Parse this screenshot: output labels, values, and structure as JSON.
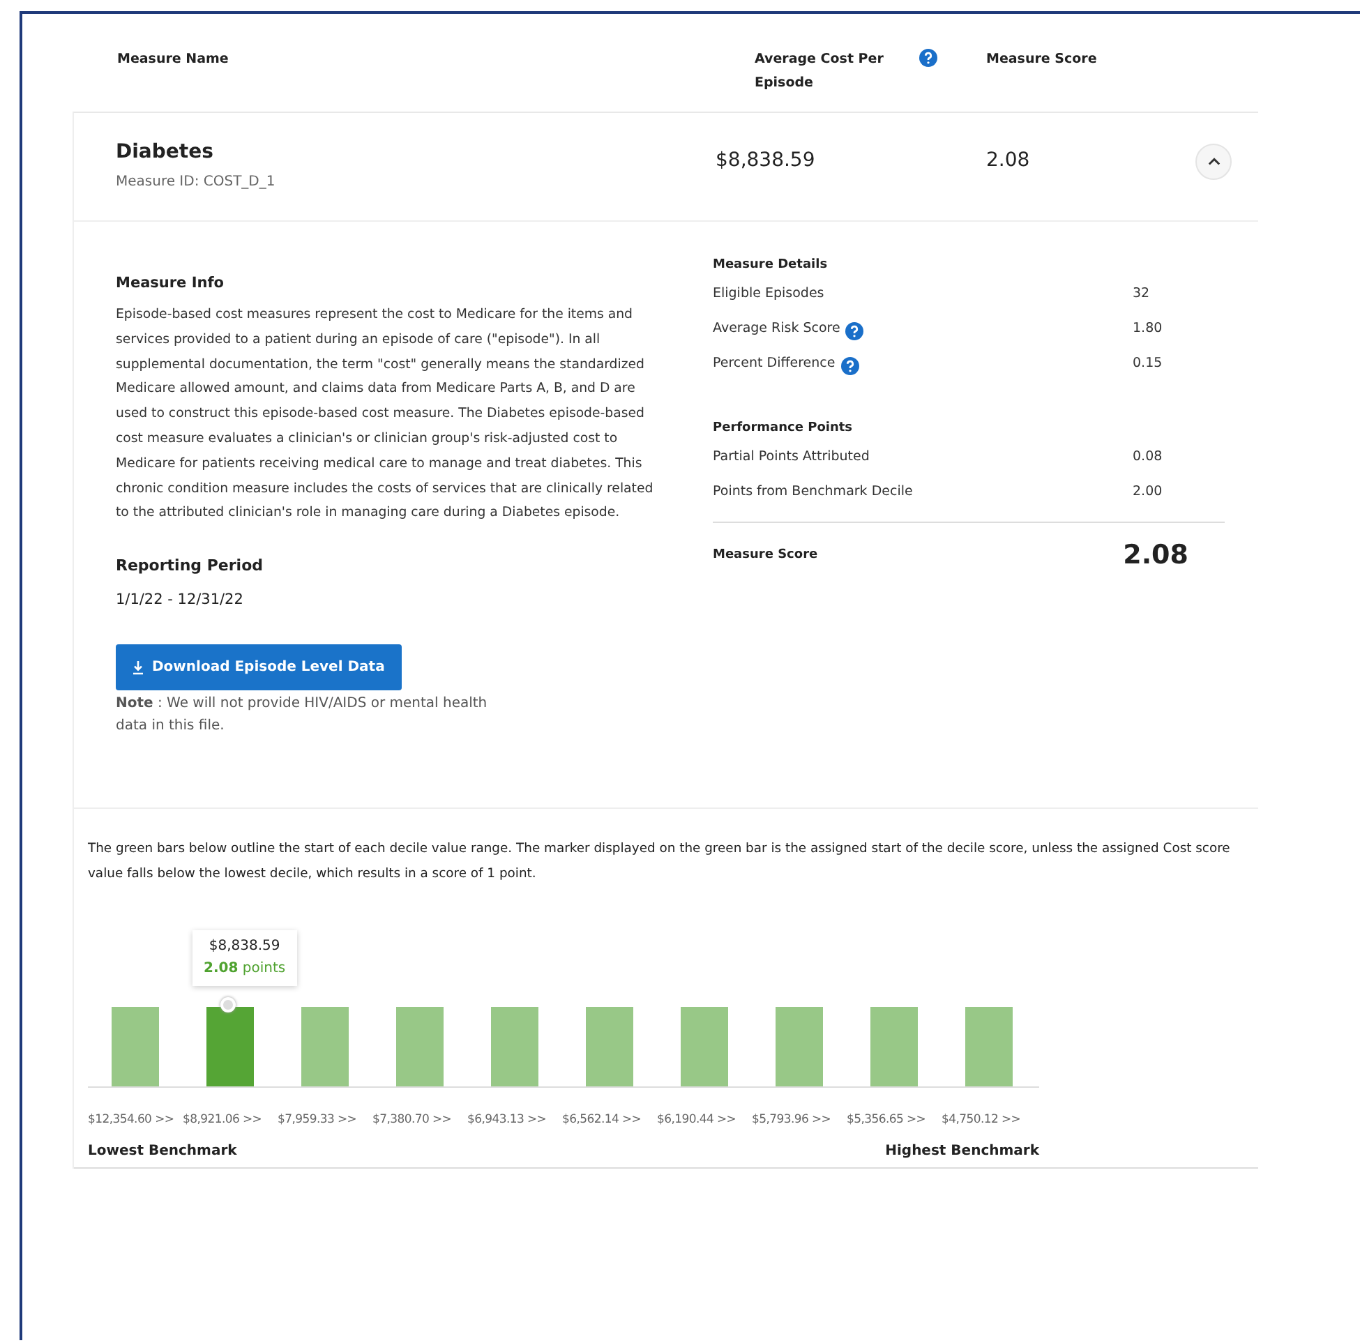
{
  "table": {
    "columns": [
      {
        "label": "Measure Name",
        "help": false
      },
      {
        "label": "Average Cost Per Episode",
        "help": true
      },
      {
        "label": "Measure Score",
        "help": false
      }
    ]
  },
  "measure": {
    "name": "Diabetes",
    "id_text": "Measure ID: COST_D_1",
    "average_cost": "$8,838.59",
    "score": "2.08",
    "expanded": true
  },
  "measure_info": {
    "title": "Measure Info",
    "text": "Episode-based cost measures represent the cost to Medicare for the items and services provided to a patient during an episode of care (\"episode\"). In all supplemental documentation, the term \"cost\" generally means the standardized Medicare allowed amount, and claims data from Medicare Parts A, B, and D are used to construct this episode-based cost measure. The Diabetes episode-based cost measure evaluates a clinician's or clinician group's risk-adjusted cost to Medicare for patients receiving medical care to manage and treat diabetes. This chronic condition measure includes the costs of services that are clinically related to the attributed clinician's role in managing care during a Diabetes episode."
  },
  "reporting_period": {
    "title": "Reporting Period",
    "value": "1/1/22 - 12/31/22"
  },
  "download_button": "Download Episode Level Data",
  "note": "**Note** : We will not provide HIV/AIDS or mental health data in this file.",
  "detail_groups": [
    {
      "title": "Measure Details",
      "rows": [
        {
          "label": "Eligible Episodes",
          "value": "32",
          "help": false
        },
        {
          "label": "Average Risk Score",
          "value": "1.80",
          "help": true
        },
        {
          "label": "Percent Difference",
          "value": "0.15",
          "help": true
        }
      ]
    },
    {
      "title": "Performance Points",
      "rows": [
        {
          "label": "Partial Points Attributed",
          "value": "0.08",
          "help": false
        },
        {
          "label": "Points from Benchmark Decile",
          "value": "2.00",
          "help": false
        }
      ]
    }
  ],
  "total": {
    "label": "Measure Score",
    "value": "2.08"
  },
  "benchmark": {
    "description": "The green bars below outline the start of each decile value range. The marker displayed on the green bar is the assigned start of the decile score, unless the assigned Cost score value falls below the lowest decile, which results in a score of 1 point.",
    "tooltip": {
      "cost": "$8,838.59",
      "points": "2.08",
      "points_label": "points"
    },
    "deciles": [
      {
        "label": "$12,354.60 >>",
        "selected": false
      },
      {
        "label": "$8,921.06 >>",
        "selected": true
      },
      {
        "label": "$7,959.33 >>",
        "selected": false
      },
      {
        "label": "$7,380.70 >>",
        "selected": false
      },
      {
        "label": "$6,943.13 >>",
        "selected": false
      },
      {
        "label": "$6,562.14 >>",
        "selected": false
      },
      {
        "label": "$6,190.44 >>",
        "selected": false
      },
      {
        "label": "$5,793.96 >>",
        "selected": false
      },
      {
        "label": "$5,356.65 >>",
        "selected": false
      },
      {
        "label": "$4,750.12 >>",
        "selected": false
      }
    ],
    "lowest_label": "Lowest Benchmark",
    "highest_label": "Highest Benchmark"
  }
}
